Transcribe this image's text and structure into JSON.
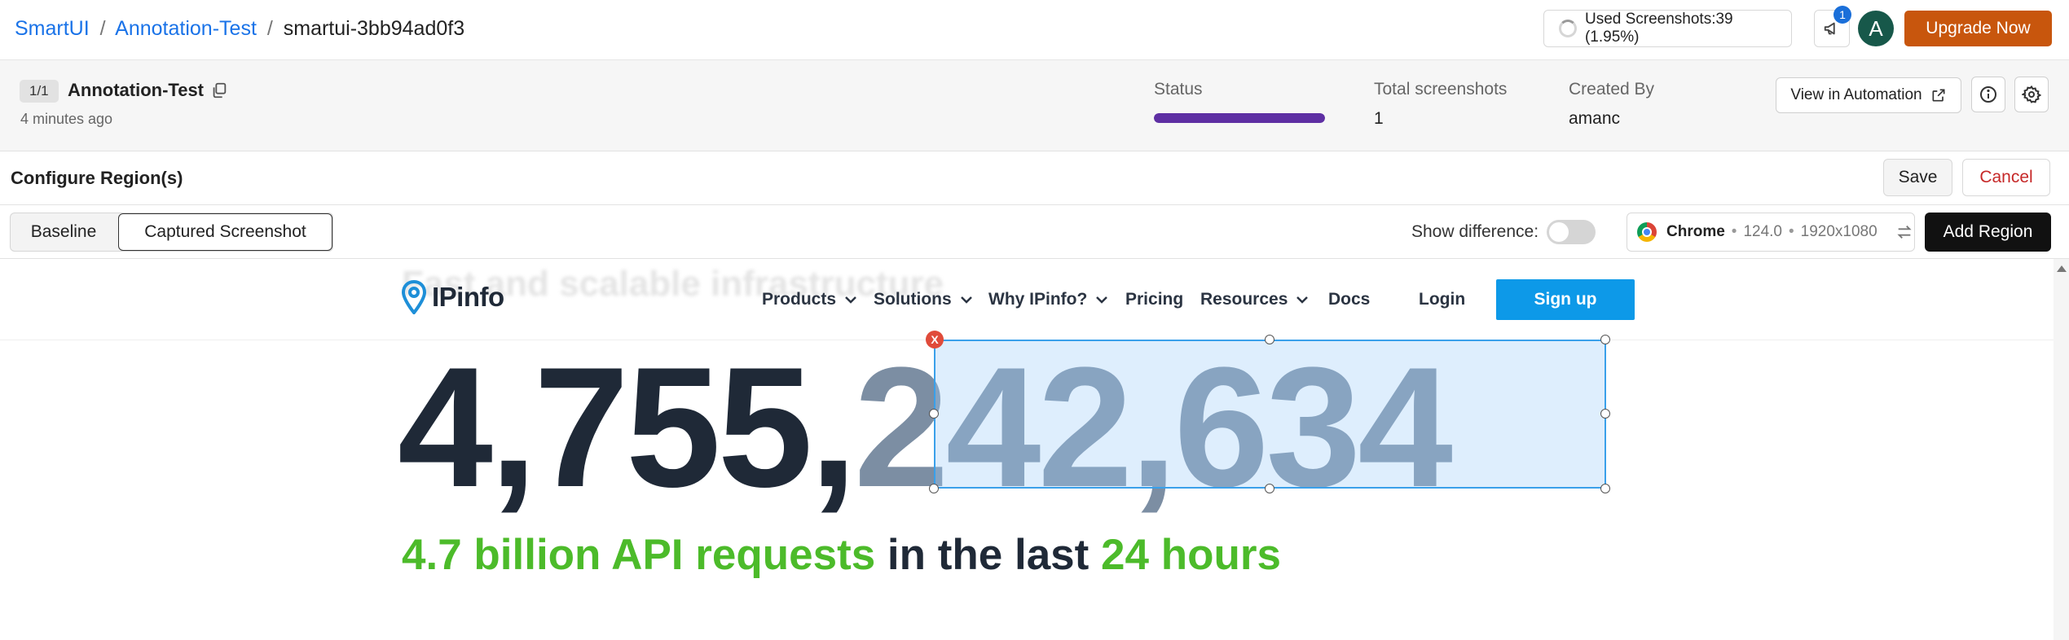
{
  "breadcrumb": {
    "root": "SmartUI",
    "project": "Annotation-Test",
    "build": "smartui-3bb94ad0f3",
    "separator": "/"
  },
  "header": {
    "usage_text": "Used Screenshots:39 (1.95%)",
    "notification_count": "1",
    "avatar_initial": "A",
    "upgrade_label": "Upgrade Now",
    "upgrade_color": "#c8560d"
  },
  "build": {
    "count_label": "1/1",
    "name": "Annotation-Test",
    "age": "4 minutes ago",
    "status_label": "Status",
    "status_progress": 1.0,
    "status_color": "#5e2fa3",
    "total_label": "Total screenshots",
    "total_value": "1",
    "created_label": "Created By",
    "created_value": "amanc",
    "automation_label": "View in Automation"
  },
  "config": {
    "title": "Configure Region(s)",
    "save_label": "Save",
    "cancel_label": "Cancel"
  },
  "toolbar": {
    "tabs": [
      {
        "label": "Baseline",
        "active": false
      },
      {
        "label": "Captured Screenshot",
        "active": true
      }
    ],
    "diff_label": "Show difference:",
    "diff_enabled": false,
    "browser": {
      "icon": "chrome-icon",
      "name": "Chrome",
      "version": "124.0",
      "resolution": "1920x1080",
      "dot": "•"
    },
    "add_region_label": "Add Region"
  },
  "screenshot": {
    "ghost_text": "Fast and scalable infrastructure",
    "logo_text": "IPinfo",
    "nav": [
      "Products",
      "Solutions",
      "Why IPinfo?",
      "Pricing",
      "Resources",
      "Docs",
      "Login"
    ],
    "signup_label": "Sign up",
    "signup_color": "#0d99e8",
    "counter_dark": "4,755,",
    "counter_muted": "242,634",
    "tagline": {
      "part1": "4.7 billion API requests",
      "part2": " in the last ",
      "part3": "24 hours"
    },
    "accent_green": "#4cbb2a",
    "region_close_label": "X"
  }
}
